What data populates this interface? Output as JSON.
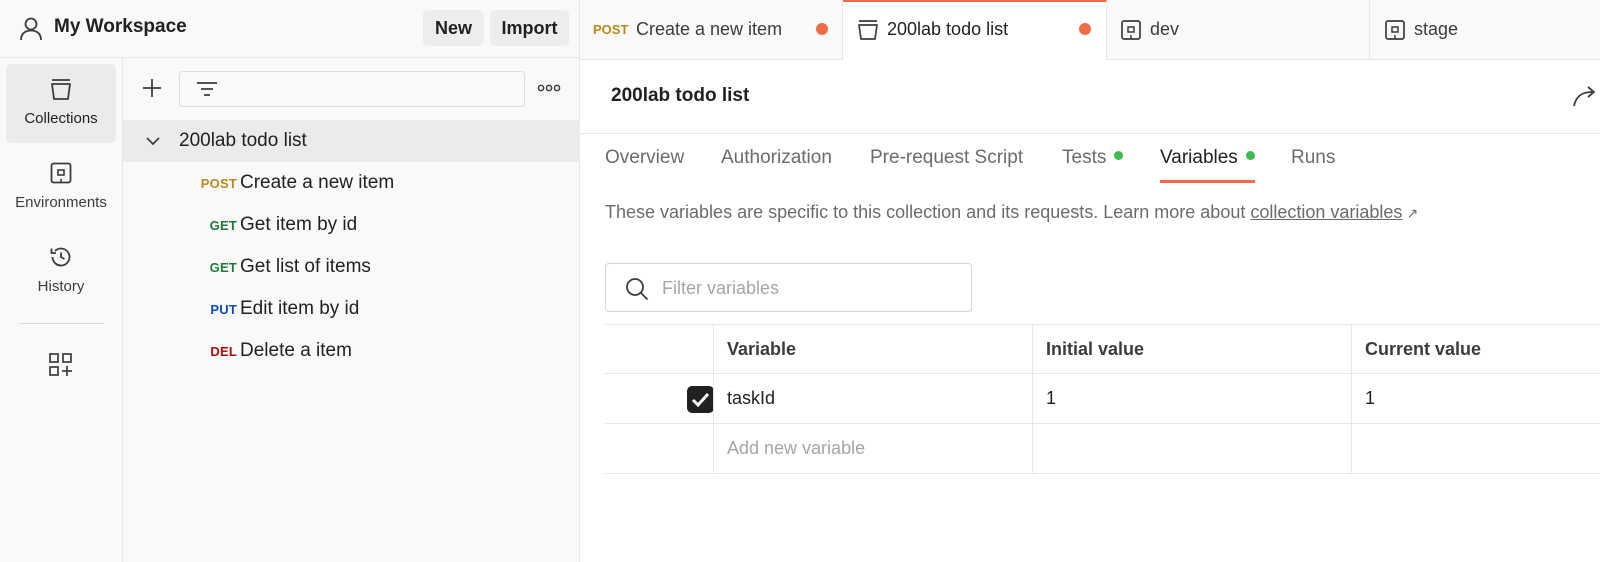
{
  "workspace": {
    "title": "My Workspace",
    "new_label": "New",
    "import_label": "Import"
  },
  "rail": {
    "items": [
      {
        "label": "Collections",
        "icon": "collections-icon",
        "active": true
      },
      {
        "label": "Environments",
        "icon": "environments-icon",
        "active": false
      },
      {
        "label": "History",
        "icon": "history-icon",
        "active": false
      }
    ],
    "apps_icon": "add-apps-icon"
  },
  "sidebar": {
    "filter_icon": "filter-icon",
    "more_icon": "more-icon",
    "collection": {
      "name": "200lab todo list",
      "expanded": true
    },
    "requests": [
      {
        "method": "POST",
        "name": "Create a new item",
        "method_color": "#b78a1d"
      },
      {
        "method": "GET",
        "name": "Get item by id",
        "method_color": "#227a39"
      },
      {
        "method": "GET",
        "name": "Get list of items",
        "method_color": "#227a39"
      },
      {
        "method": "PUT",
        "name": "Edit item by id",
        "method_color": "#0c4cb3"
      },
      {
        "method": "DEL",
        "name": "Delete a item",
        "method_color": "#a1140f"
      }
    ]
  },
  "tabs": [
    {
      "method": "POST",
      "label": "Create a new item",
      "active": false,
      "unsaved": true
    },
    {
      "label": "200lab todo list",
      "icon": "collection-icon",
      "active": true,
      "unsaved": true
    },
    {
      "label": "dev",
      "icon": "environment-icon",
      "active": false
    },
    {
      "label": "stage",
      "icon": "environment-icon",
      "active": false
    }
  ],
  "main": {
    "title": "200lab todo list",
    "subtabs": [
      {
        "label": "Overview",
        "dot": false
      },
      {
        "label": "Authorization",
        "dot": false
      },
      {
        "label": "Pre-request Script",
        "dot": false
      },
      {
        "label": "Tests",
        "dot": true
      },
      {
        "label": "Variables",
        "dot": true,
        "active": true
      },
      {
        "label": "Runs",
        "dot": false
      }
    ],
    "helper_text": "These variables are specific to this collection and its requests. Learn more about",
    "helper_link": "collection variables",
    "helper_arrow": "↗",
    "filter_placeholder": "Filter variables",
    "table": {
      "headers": [
        "Variable",
        "Initial value",
        "Current value"
      ],
      "rows": [
        {
          "checked": true,
          "variable": "taskId",
          "initial": "1",
          "current": "1"
        }
      ],
      "add_placeholder": "Add new variable"
    }
  },
  "colors": {
    "accent": "#ef6c47",
    "dot_green": "#3fb950",
    "unsaved_dot": "#ef6c47"
  }
}
